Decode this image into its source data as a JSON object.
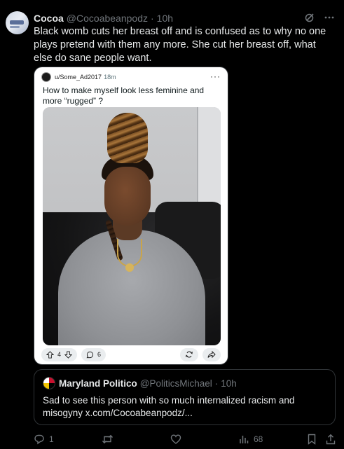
{
  "tweet": {
    "display_name": "Cocoa",
    "handle": "@Cocoabeanpodz",
    "dot": "·",
    "time": "10h",
    "text": "Black womb cuts her breast off and is confused as to why no one plays pretend with them any more. She cut her breast off, what else do sane people want."
  },
  "media": {
    "reddit_user": "u/Some_Ad2017",
    "reddit_time": "18m",
    "reddit_more": "···",
    "reddit_title": "How to make myself look less feminine and more “rugged” ?",
    "upvotes": "4",
    "comments": "6"
  },
  "quote": {
    "display_name": "Maryland Politico",
    "handle": "@PoliticsMichael",
    "dot": "·",
    "time": "10h",
    "text": "Sad to see this person with so much internalized racism and misogyny x.com/Cocoabeanpodz/..."
  },
  "actions": {
    "replies": "1",
    "retweets": "",
    "likes": "",
    "views": "68"
  },
  "icons": {
    "header": [
      "grok-icon",
      "more-icon"
    ],
    "actions": [
      "reply-icon",
      "retweet-icon",
      "like-icon",
      "views-icon",
      "bookmark-icon",
      "share-icon"
    ]
  },
  "colors": {
    "background": "#000000",
    "text": "#e7e9ea",
    "muted": "#71767b",
    "border": "#2f3336"
  }
}
